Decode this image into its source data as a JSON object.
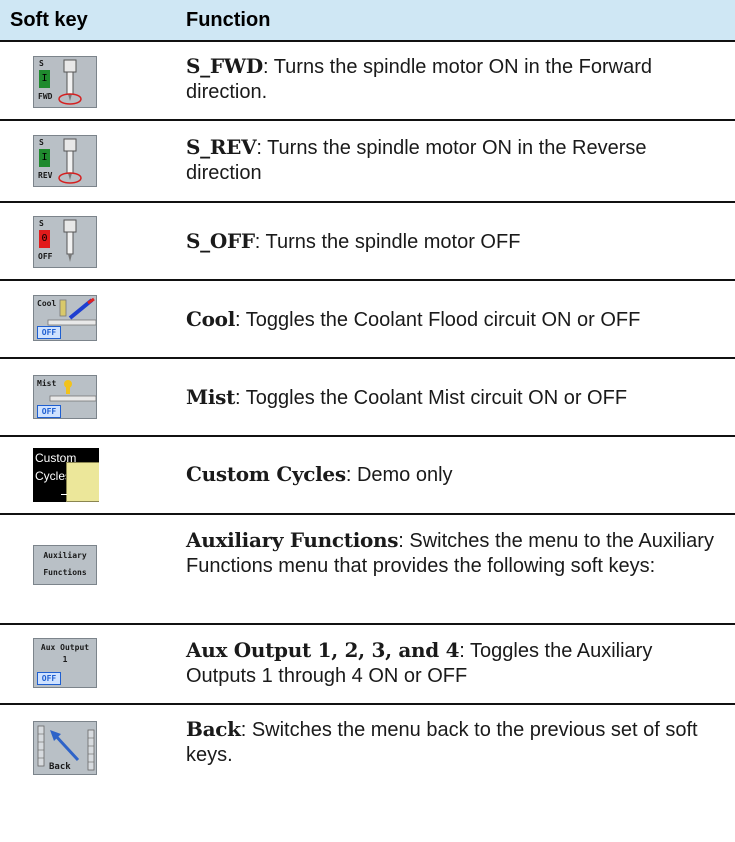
{
  "table": {
    "header": {
      "soft_key": "Soft key",
      "function": "Function"
    },
    "rows": [
      {
        "key_top": "S",
        "key_state": "I",
        "key_bottom": "FWD",
        "state_color": "#1f8a2e",
        "name": "S_FWD",
        "desc": ": Turns the spindle motor ON in the Forward direction.",
        "icon": "spindle-icon"
      },
      {
        "key_top": "S",
        "key_state": "I",
        "key_bottom": "REV",
        "state_color": "#1f8a2e",
        "name": "S_REV",
        "desc": ": Turns the spindle motor ON in the Reverse direction",
        "icon": "spindle-icon"
      },
      {
        "key_top": "S",
        "key_state": "0",
        "key_bottom": "OFF",
        "state_color": "#e21b1b",
        "name": "S_OFF",
        "desc": ": Turns the spindle motor OFF",
        "icon": "spindle-icon"
      },
      {
        "key_label": "Cool",
        "key_badge": "OFF",
        "name": "Cool",
        "desc": ": Toggles the Coolant Flood circuit ON or OFF",
        "icon": "coolant-flood-icon"
      },
      {
        "key_label": "Mist",
        "key_badge": "OFF",
        "name": "Mist",
        "desc": ": Toggles the Coolant Mist circuit ON or OFF",
        "icon": "coolant-mist-icon"
      },
      {
        "key_line1": "Custom",
        "key_line2": "Cycles",
        "name": "Custom Cycles",
        "desc": ": Demo only",
        "icon": "custom-cycles-icon"
      },
      {
        "key_line1": "Auxiliary",
        "key_line2": "Functions",
        "name": "Auxiliary Functions",
        "desc": ": Switches the menu to the Auxiliary Functions menu that provides the following soft keys:",
        "icon": "aux-functions-icon"
      },
      {
        "key_line1": "Aux Output",
        "key_line2": "1",
        "key_badge": "OFF",
        "name": "Aux Output 1, 2, 3, and 4",
        "desc": ": Toggles the Auxiliary Outputs 1 through 4 ON or OFF",
        "icon": "aux-output-icon"
      },
      {
        "key_label": "Back",
        "name": "Back",
        "desc": ": Switches the menu back to the previous set of soft keys.",
        "icon": "back-arrow-icon"
      }
    ]
  }
}
